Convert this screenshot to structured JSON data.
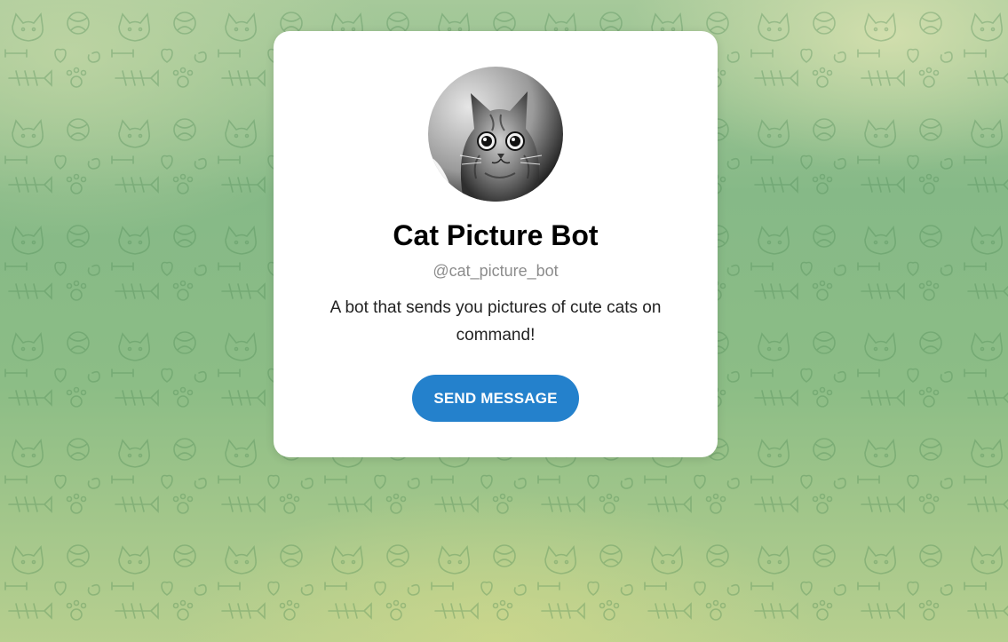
{
  "bot": {
    "name": "Cat Picture Bot",
    "username": "@cat_picture_bot",
    "description": "A bot that sends you pictures of cute cats on command!"
  },
  "actions": {
    "send_message_label": "SEND MESSAGE"
  },
  "colors": {
    "accent": "#2481cc",
    "background_green": "#8cbd86",
    "card": "#ffffff"
  },
  "icons": {
    "avatar": "cat-photo",
    "background": "cat-doodle-pattern"
  }
}
